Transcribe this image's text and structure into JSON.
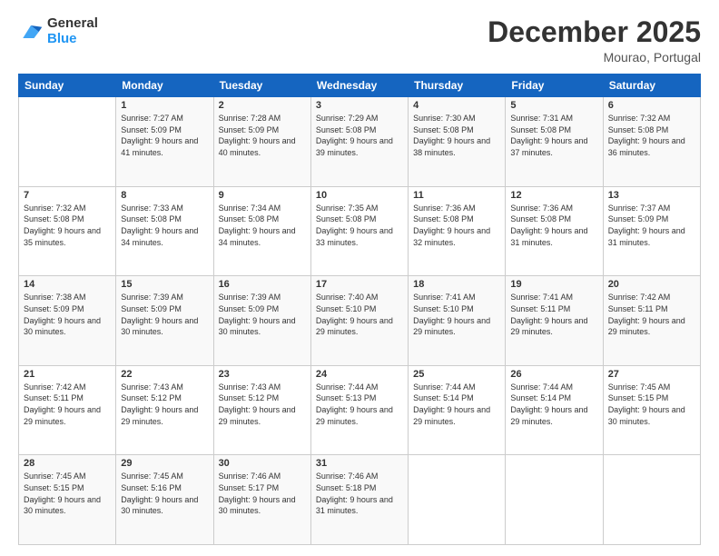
{
  "header": {
    "logo_general": "General",
    "logo_blue": "Blue",
    "month_title": "December 2025",
    "subtitle": "Mourao, Portugal"
  },
  "days_header": [
    "Sunday",
    "Monday",
    "Tuesday",
    "Wednesday",
    "Thursday",
    "Friday",
    "Saturday"
  ],
  "weeks": [
    [
      {
        "day": "",
        "sunrise": "",
        "sunset": "",
        "daylight": ""
      },
      {
        "day": "1",
        "sunrise": "Sunrise: 7:27 AM",
        "sunset": "Sunset: 5:09 PM",
        "daylight": "Daylight: 9 hours and 41 minutes."
      },
      {
        "day": "2",
        "sunrise": "Sunrise: 7:28 AM",
        "sunset": "Sunset: 5:09 PM",
        "daylight": "Daylight: 9 hours and 40 minutes."
      },
      {
        "day": "3",
        "sunrise": "Sunrise: 7:29 AM",
        "sunset": "Sunset: 5:08 PM",
        "daylight": "Daylight: 9 hours and 39 minutes."
      },
      {
        "day": "4",
        "sunrise": "Sunrise: 7:30 AM",
        "sunset": "Sunset: 5:08 PM",
        "daylight": "Daylight: 9 hours and 38 minutes."
      },
      {
        "day": "5",
        "sunrise": "Sunrise: 7:31 AM",
        "sunset": "Sunset: 5:08 PM",
        "daylight": "Daylight: 9 hours and 37 minutes."
      },
      {
        "day": "6",
        "sunrise": "Sunrise: 7:32 AM",
        "sunset": "Sunset: 5:08 PM",
        "daylight": "Daylight: 9 hours and 36 minutes."
      }
    ],
    [
      {
        "day": "7",
        "sunrise": "Sunrise: 7:32 AM",
        "sunset": "Sunset: 5:08 PM",
        "daylight": "Daylight: 9 hours and 35 minutes."
      },
      {
        "day": "8",
        "sunrise": "Sunrise: 7:33 AM",
        "sunset": "Sunset: 5:08 PM",
        "daylight": "Daylight: 9 hours and 34 minutes."
      },
      {
        "day": "9",
        "sunrise": "Sunrise: 7:34 AM",
        "sunset": "Sunset: 5:08 PM",
        "daylight": "Daylight: 9 hours and 34 minutes."
      },
      {
        "day": "10",
        "sunrise": "Sunrise: 7:35 AM",
        "sunset": "Sunset: 5:08 PM",
        "daylight": "Daylight: 9 hours and 33 minutes."
      },
      {
        "day": "11",
        "sunrise": "Sunrise: 7:36 AM",
        "sunset": "Sunset: 5:08 PM",
        "daylight": "Daylight: 9 hours and 32 minutes."
      },
      {
        "day": "12",
        "sunrise": "Sunrise: 7:36 AM",
        "sunset": "Sunset: 5:08 PM",
        "daylight": "Daylight: 9 hours and 31 minutes."
      },
      {
        "day": "13",
        "sunrise": "Sunrise: 7:37 AM",
        "sunset": "Sunset: 5:09 PM",
        "daylight": "Daylight: 9 hours and 31 minutes."
      }
    ],
    [
      {
        "day": "14",
        "sunrise": "Sunrise: 7:38 AM",
        "sunset": "Sunset: 5:09 PM",
        "daylight": "Daylight: 9 hours and 30 minutes."
      },
      {
        "day": "15",
        "sunrise": "Sunrise: 7:39 AM",
        "sunset": "Sunset: 5:09 PM",
        "daylight": "Daylight: 9 hours and 30 minutes."
      },
      {
        "day": "16",
        "sunrise": "Sunrise: 7:39 AM",
        "sunset": "Sunset: 5:09 PM",
        "daylight": "Daylight: 9 hours and 30 minutes."
      },
      {
        "day": "17",
        "sunrise": "Sunrise: 7:40 AM",
        "sunset": "Sunset: 5:10 PM",
        "daylight": "Daylight: 9 hours and 29 minutes."
      },
      {
        "day": "18",
        "sunrise": "Sunrise: 7:41 AM",
        "sunset": "Sunset: 5:10 PM",
        "daylight": "Daylight: 9 hours and 29 minutes."
      },
      {
        "day": "19",
        "sunrise": "Sunrise: 7:41 AM",
        "sunset": "Sunset: 5:11 PM",
        "daylight": "Daylight: 9 hours and 29 minutes."
      },
      {
        "day": "20",
        "sunrise": "Sunrise: 7:42 AM",
        "sunset": "Sunset: 5:11 PM",
        "daylight": "Daylight: 9 hours and 29 minutes."
      }
    ],
    [
      {
        "day": "21",
        "sunrise": "Sunrise: 7:42 AM",
        "sunset": "Sunset: 5:11 PM",
        "daylight": "Daylight: 9 hours and 29 minutes."
      },
      {
        "day": "22",
        "sunrise": "Sunrise: 7:43 AM",
        "sunset": "Sunset: 5:12 PM",
        "daylight": "Daylight: 9 hours and 29 minutes."
      },
      {
        "day": "23",
        "sunrise": "Sunrise: 7:43 AM",
        "sunset": "Sunset: 5:12 PM",
        "daylight": "Daylight: 9 hours and 29 minutes."
      },
      {
        "day": "24",
        "sunrise": "Sunrise: 7:44 AM",
        "sunset": "Sunset: 5:13 PM",
        "daylight": "Daylight: 9 hours and 29 minutes."
      },
      {
        "day": "25",
        "sunrise": "Sunrise: 7:44 AM",
        "sunset": "Sunset: 5:14 PM",
        "daylight": "Daylight: 9 hours and 29 minutes."
      },
      {
        "day": "26",
        "sunrise": "Sunrise: 7:44 AM",
        "sunset": "Sunset: 5:14 PM",
        "daylight": "Daylight: 9 hours and 29 minutes."
      },
      {
        "day": "27",
        "sunrise": "Sunrise: 7:45 AM",
        "sunset": "Sunset: 5:15 PM",
        "daylight": "Daylight: 9 hours and 30 minutes."
      }
    ],
    [
      {
        "day": "28",
        "sunrise": "Sunrise: 7:45 AM",
        "sunset": "Sunset: 5:15 PM",
        "daylight": "Daylight: 9 hours and 30 minutes."
      },
      {
        "day": "29",
        "sunrise": "Sunrise: 7:45 AM",
        "sunset": "Sunset: 5:16 PM",
        "daylight": "Daylight: 9 hours and 30 minutes."
      },
      {
        "day": "30",
        "sunrise": "Sunrise: 7:46 AM",
        "sunset": "Sunset: 5:17 PM",
        "daylight": "Daylight: 9 hours and 30 minutes."
      },
      {
        "day": "31",
        "sunrise": "Sunrise: 7:46 AM",
        "sunset": "Sunset: 5:18 PM",
        "daylight": "Daylight: 9 hours and 31 minutes."
      },
      {
        "day": "",
        "sunrise": "",
        "sunset": "",
        "daylight": ""
      },
      {
        "day": "",
        "sunrise": "",
        "sunset": "",
        "daylight": ""
      },
      {
        "day": "",
        "sunrise": "",
        "sunset": "",
        "daylight": ""
      }
    ]
  ]
}
